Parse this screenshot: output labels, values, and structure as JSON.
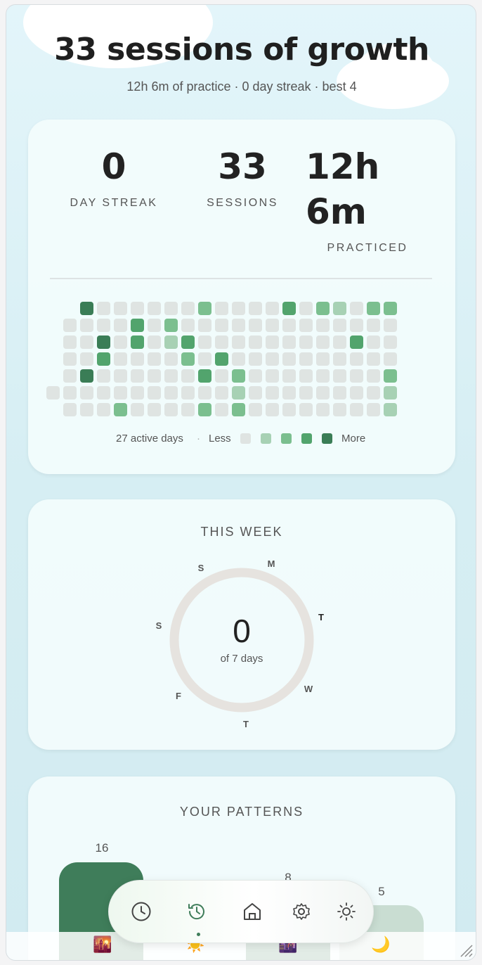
{
  "header": {
    "title": "33 sessions of growth",
    "subtitle": "12h 6m of practice · 0 day streak · best 4"
  },
  "stats": {
    "streak": {
      "value": "0",
      "label": "DAY STREAK"
    },
    "sessions": {
      "value": "33",
      "label": "SESSIONS"
    },
    "practiced": {
      "value_line1": "12h",
      "value_line2": "6m",
      "label": "PRACTICED"
    }
  },
  "heatmap": {
    "rows": [
      "4000000200003021022",
      "00003020000000000000",
      "00403013000000000300",
      "00300002030000000000",
      "04000000302000000002",
      "000000000001000000001",
      "00020000202000000001"
    ],
    "active_days_label": "27 active days",
    "separator": "·",
    "less_label": "Less",
    "more_label": "More",
    "colors": [
      "#dfe4e2",
      "#a7d1b4",
      "#7bbf8f",
      "#52a46d",
      "#3a7d56"
    ]
  },
  "this_week": {
    "title": "THIS WEEK",
    "count": "0",
    "of_label": "of 7 days",
    "days": [
      "M",
      "T",
      "W",
      "T",
      "F",
      "S",
      "S"
    ]
  },
  "patterns": {
    "title": "YOUR PATTERNS",
    "bars": [
      {
        "value": "16",
        "color": "#3f7d5a"
      },
      {
        "value": "8",
        "color": "#3f7d5a"
      },
      {
        "value": "5",
        "color": "#c9ddd2"
      }
    ]
  },
  "nav": {
    "items": [
      "clock-icon",
      "history-icon",
      "home-icon",
      "settings-icon",
      "brightness-icon"
    ],
    "active_index": 1
  },
  "emoji_row": [
    "🌇",
    "☀️",
    "🌆",
    "🌙"
  ]
}
